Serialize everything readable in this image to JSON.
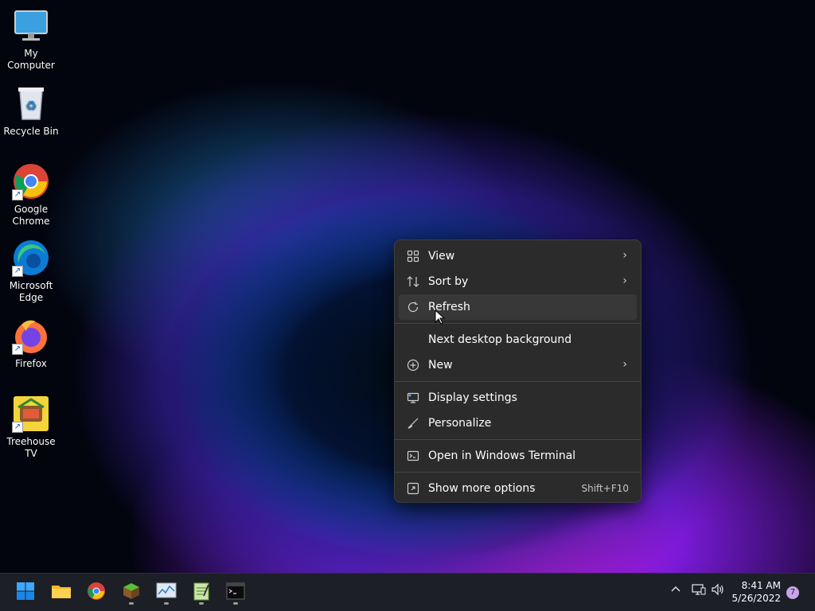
{
  "desktop": {
    "icons": [
      {
        "label": "My Computer",
        "icon": "monitor-icon"
      },
      {
        "label": "Recycle Bin",
        "icon": "recycle-bin-icon"
      },
      {
        "label": "Google Chrome",
        "icon": "chrome-icon"
      },
      {
        "label": "Microsoft Edge",
        "icon": "edge-icon"
      },
      {
        "label": "Firefox",
        "icon": "firefox-icon"
      },
      {
        "label": "Treehouse TV",
        "icon": "treehouse-tv-icon"
      }
    ]
  },
  "context_menu": {
    "items": [
      {
        "label": "View",
        "icon": "grid-icon",
        "submenu": true
      },
      {
        "label": "Sort by",
        "icon": "sort-icon",
        "submenu": true
      },
      {
        "label": "Refresh",
        "icon": "refresh-icon",
        "hover": true
      },
      {
        "label": "Next desktop background"
      },
      {
        "label": "New",
        "icon": "plus-circle-icon",
        "submenu": true
      },
      {
        "label": "Display settings",
        "icon": "display-icon"
      },
      {
        "label": "Personalize",
        "icon": "brush-icon"
      },
      {
        "label": "Open in Windows Terminal",
        "icon": "terminal-icon"
      },
      {
        "label": "Show more options",
        "icon": "more-options-icon",
        "shortcut": "Shift+F10"
      }
    ]
  },
  "taskbar": {
    "apps": [
      "start-icon",
      "file-explorer-icon",
      "chrome-icon",
      "minecraft-icon",
      "resource-monitor-icon",
      "notepad-icon",
      "terminal-icon"
    ],
    "clock": {
      "time": "8:41 AM",
      "date": "5/26/2022"
    },
    "notification_count": "7"
  },
  "colors": {
    "menu_bg": "#2b2b2b",
    "taskbar_bg": "#1c1f26",
    "accent": "#0078d4"
  }
}
